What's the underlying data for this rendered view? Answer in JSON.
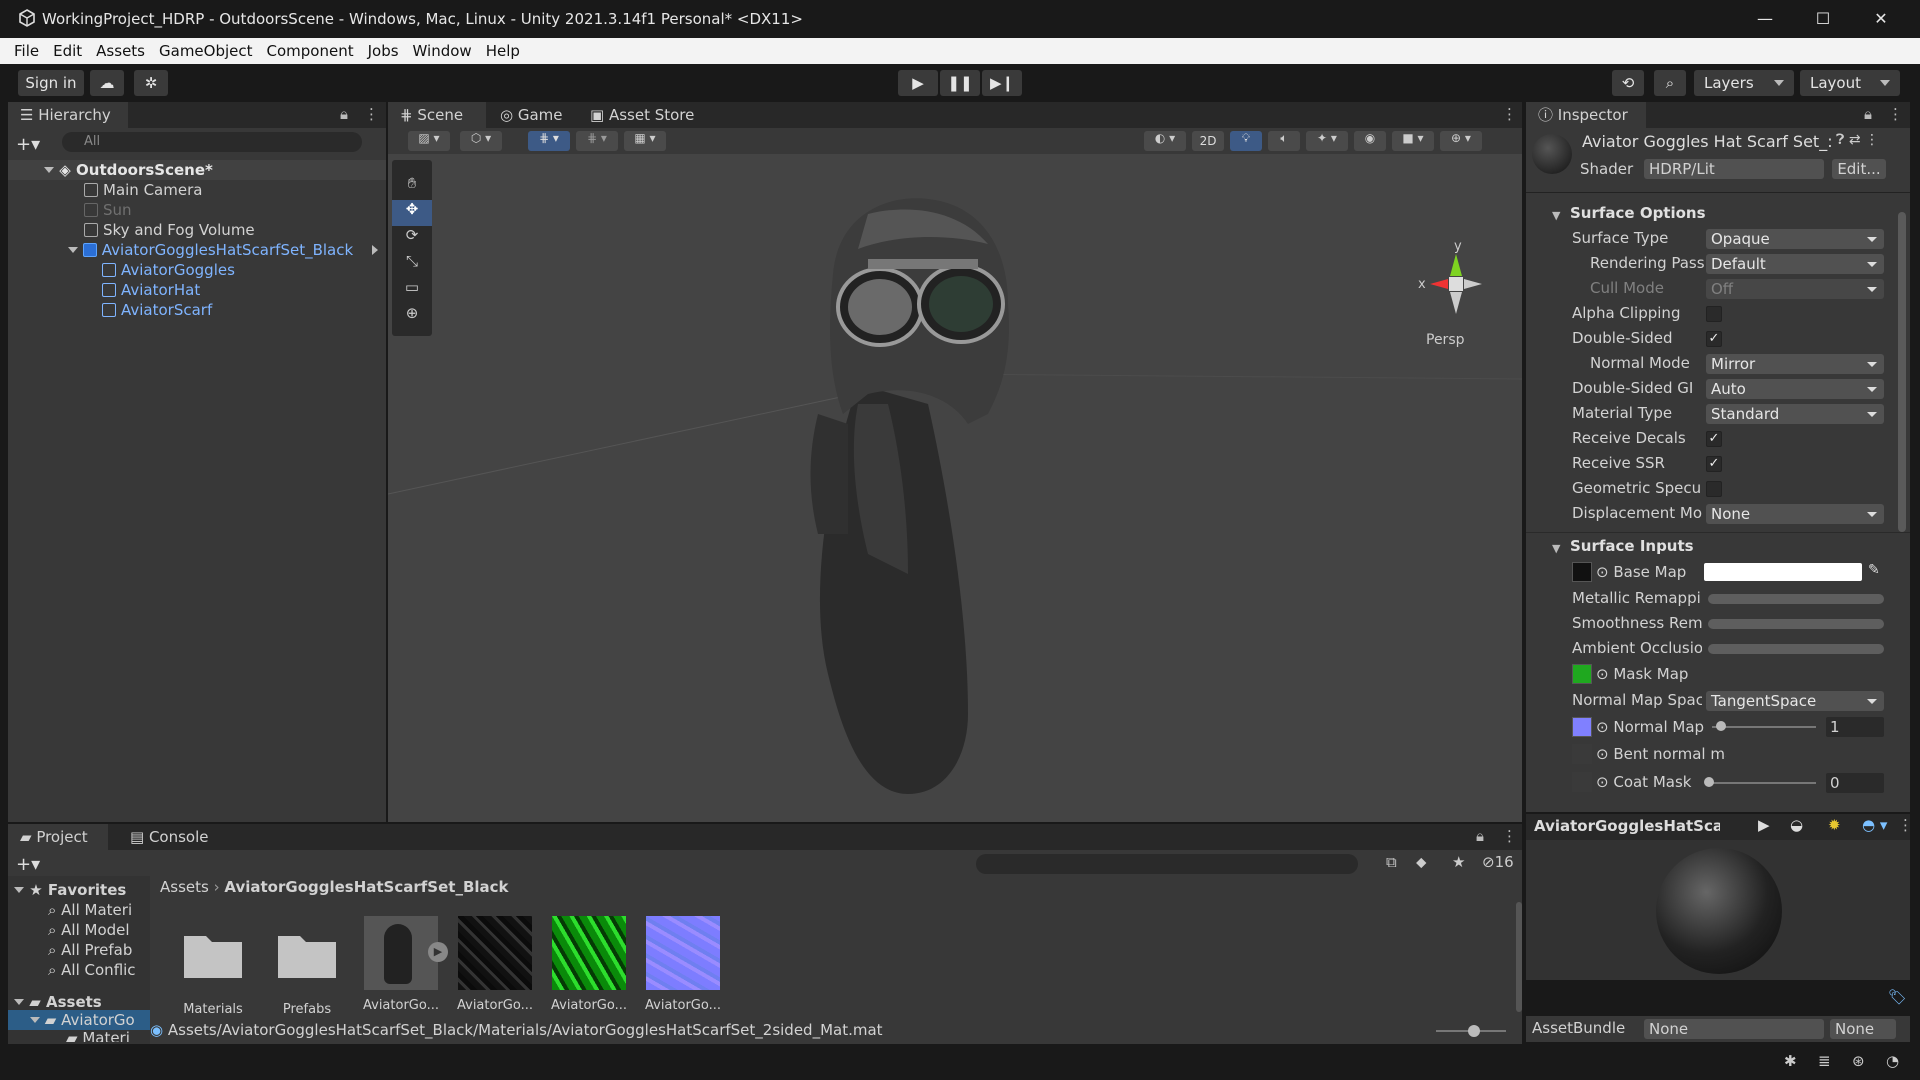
{
  "window": {
    "title": "WorkingProject_HDRP - OutdoorsScene - Windows, Mac, Linux - Unity 2021.3.14f1 Personal* <DX11>"
  },
  "menu": [
    "File",
    "Edit",
    "Assets",
    "GameObject",
    "Component",
    "Jobs",
    "Window",
    "Help"
  ],
  "toolbar": {
    "sign_in": "Sign in",
    "layers": "Layers",
    "layout": "Layout"
  },
  "hierarchy": {
    "title": "Hierarchy",
    "search_placeholder": "All",
    "scene": "OutdoorsScene*",
    "items": [
      "Main Camera",
      "Sun",
      "Sky and Fog Volume",
      "AviatorGogglesHatScarfSet_Black",
      "AviatorGoggles",
      "AviatorHat",
      "AviatorScarf"
    ]
  },
  "scene_view": {
    "tabs": [
      "Scene",
      "Game",
      "Asset Store"
    ],
    "mode_2d": "2D",
    "persp": "Persp",
    "gizmo_y": "y",
    "gizmo_x": "x"
  },
  "inspector": {
    "title": "Inspector",
    "material_name": "Aviator Goggles Hat Scarf Set_:",
    "shader_label": "Shader",
    "shader_value": "HDRP/Lit",
    "edit_button": "Edit...",
    "surface_options": "Surface Options",
    "surface_type_label": "Surface Type",
    "surface_type_value": "Opaque",
    "rendering_pass_label": "Rendering Pass",
    "rendering_pass_value": "Default",
    "cull_mode_label": "Cull Mode",
    "cull_mode_value": "Off",
    "alpha_clipping_label": "Alpha Clipping",
    "alpha_clipping": false,
    "double_sided_label": "Double-Sided",
    "double_sided": true,
    "normal_mode_label": "Normal Mode",
    "normal_mode_value": "Mirror",
    "double_sided_gi_label": "Double-Sided GI",
    "double_sided_gi_value": "Auto",
    "material_type_label": "Material Type",
    "material_type_value": "Standard",
    "receive_decals_label": "Receive Decals",
    "receive_decals": true,
    "receive_ssr_label": "Receive SSR",
    "receive_ssr": true,
    "geometric_specular_label": "Geometric Speculi",
    "displacement_mode_label": "Displacement Moc",
    "displacement_mode_value": "None",
    "surface_inputs": "Surface Inputs",
    "base_map_label": "Base Map",
    "metallic_label": "Metallic Remappir",
    "smoothness_label": "Smoothness Rema",
    "ambient_occlusion_label": "Ambient Occlusior",
    "mask_map_label": "Mask Map",
    "normal_map_space_label": "Normal Map Spac",
    "normal_map_space_value": "TangentSpace",
    "normal_map_label": "Normal Map",
    "normal_map_value": "1",
    "bent_normal_label": "Bent normal ma",
    "coat_mask_label": "Coat Mask",
    "coat_mask_value": "0",
    "preview_title": "AviatorGogglesHatScarl",
    "assetbundle_label": "AssetBundle",
    "assetbundle_value": "None",
    "assetbundle_variant": "None"
  },
  "project": {
    "tabs": [
      "Project",
      "Console"
    ],
    "favorites": "Favorites",
    "favorite_items": [
      "All Materi",
      "All Model",
      "All Prefab",
      "All Conflic"
    ],
    "assets_root": "Assets",
    "tree_child": "AviatorGo",
    "tree_grandchild": "Materi",
    "breadcrumb_root": "Assets",
    "breadcrumb_folder": "AviatorGogglesHatScarfSet_Black",
    "hidden_count": "16",
    "assets": [
      "Materials",
      "Prefabs",
      "AviatorGo...",
      "AviatorGo...",
      "AviatorGo...",
      "AviatorGo..."
    ],
    "selected_path": "Assets/AviatorGogglesHatScarfSet_Black/Materials/AviatorGogglesHatScarfSet_2sided_Mat.mat"
  }
}
